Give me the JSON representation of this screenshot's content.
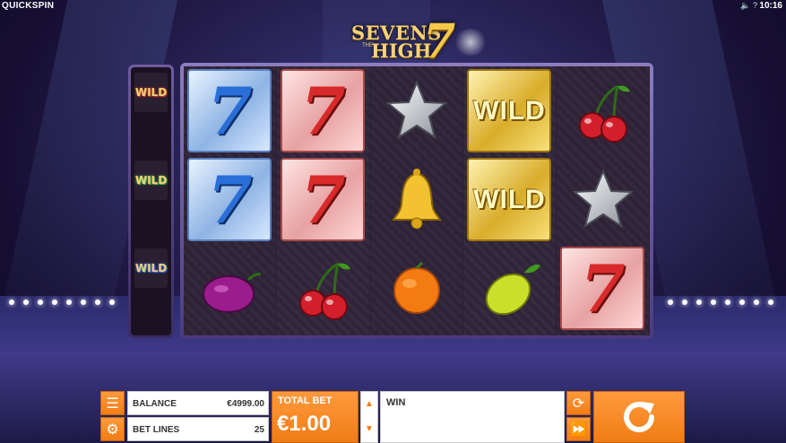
{
  "topbar": {
    "brand": "QUICKSPIN",
    "time": "10:16",
    "sound_icon": "speaker-icon",
    "help": "?"
  },
  "logo": {
    "line1": "SEVENS",
    "the": "THE",
    "line2": "HIGH",
    "seven": "7"
  },
  "side_multipliers": [
    {
      "label": "WILD",
      "color": "#c0392b"
    },
    {
      "label": "WILD",
      "color": "#4caf50"
    },
    {
      "label": "WILD",
      "color": "#3a6fd8"
    }
  ],
  "reels": [
    [
      "blue-seven",
      "blue-seven",
      "plum"
    ],
    [
      "red-seven",
      "red-seven",
      "cherry"
    ],
    [
      "star",
      "bell",
      "orange"
    ],
    [
      "wild",
      "wild",
      "lemon"
    ],
    [
      "cherry",
      "star",
      "red-seven"
    ]
  ],
  "symbol_text": {
    "seven": "7",
    "wild": "WILD"
  },
  "panel": {
    "menu_icon": "hamburger-icon",
    "settings_icon": "gear-icon",
    "balance_label": "BALANCE",
    "balance_value": "€4999.00",
    "betlines_label": "BET LINES",
    "betlines_value": "25",
    "totalbet_label": "TOTAL BET",
    "totalbet_value": "€1.00",
    "win_label": "WIN",
    "autoplay_icon": "autoplay-icon",
    "fast_icon": "fast-forward-icon",
    "spin_icon": "spin-icon"
  },
  "colors": {
    "accent": "#f07d16",
    "panel_bg": "#ffffff"
  }
}
